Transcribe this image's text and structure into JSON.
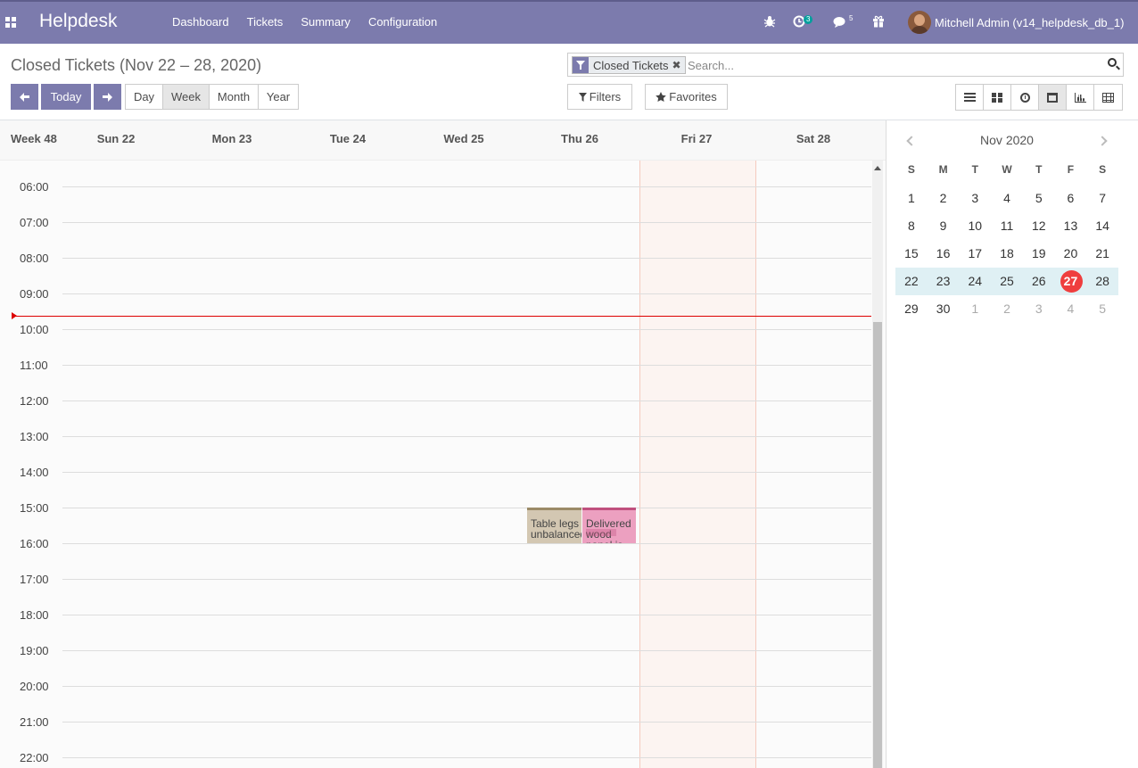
{
  "navbar": {
    "brand": "Helpdesk",
    "menu": [
      "Dashboard",
      "Tickets",
      "Summary",
      "Configuration"
    ],
    "activity_count": "3",
    "messages_count": "5",
    "user_name": "Mitchell Admin (v14_helpdesk_db_1)",
    "bg_color": "#7c7bad"
  },
  "control_panel": {
    "breadcrumb": "Closed Tickets (Nov 22 – 28, 2020)",
    "search": {
      "facet_label": "Closed Tickets",
      "facet_remove": "✖",
      "placeholder": "Search..."
    },
    "nav": {
      "today_label": "Today"
    },
    "scales": [
      "Day",
      "Week",
      "Month",
      "Year"
    ],
    "active_scale": "Week",
    "filters_label": "Filters",
    "favorites_label": "Favorites",
    "views": [
      "list",
      "kanban",
      "activity",
      "calendar",
      "graph",
      "pivot"
    ],
    "active_view": "calendar"
  },
  "calendar": {
    "week_label": "Week 48",
    "days": [
      "Sun 22",
      "Mon 23",
      "Tue 24",
      "Wed 25",
      "Thu 26",
      "Fri 27",
      "Sat 28"
    ],
    "today_column": "Fri 27",
    "hours": [
      "06:00",
      "07:00",
      "08:00",
      "09:00",
      "10:00",
      "11:00",
      "12:00",
      "13:00",
      "14:00",
      "15:00",
      "16:00",
      "17:00",
      "18:00",
      "19:00",
      "20:00",
      "21:00",
      "22:00"
    ],
    "events": [
      {
        "title": "Table legs unbalanced",
        "day": "Thu 26",
        "start": "15:00",
        "color": "#d3c7b2"
      },
      {
        "title": "Delivered wood panel is",
        "day": "Thu 26",
        "start": "15:00",
        "color": "#eca0c0"
      }
    ],
    "today_highlight": "#fcf4f1",
    "now_line_color": "#dd0000"
  },
  "mini_calendar": {
    "title": "Nov 2020",
    "weekdays": [
      "S",
      "M",
      "T",
      "W",
      "T",
      "F",
      "S"
    ],
    "weeks": [
      [
        "1",
        "2",
        "3",
        "4",
        "5",
        "6",
        "7"
      ],
      [
        "8",
        "9",
        "10",
        "11",
        "12",
        "13",
        "14"
      ],
      [
        "15",
        "16",
        "17",
        "18",
        "19",
        "20",
        "21"
      ],
      [
        "22",
        "23",
        "24",
        "25",
        "26",
        "27",
        "28"
      ],
      [
        "29",
        "30",
        "1",
        "2",
        "3",
        "4",
        "5"
      ]
    ],
    "today": "27",
    "today_color": "#ef3e3e"
  }
}
